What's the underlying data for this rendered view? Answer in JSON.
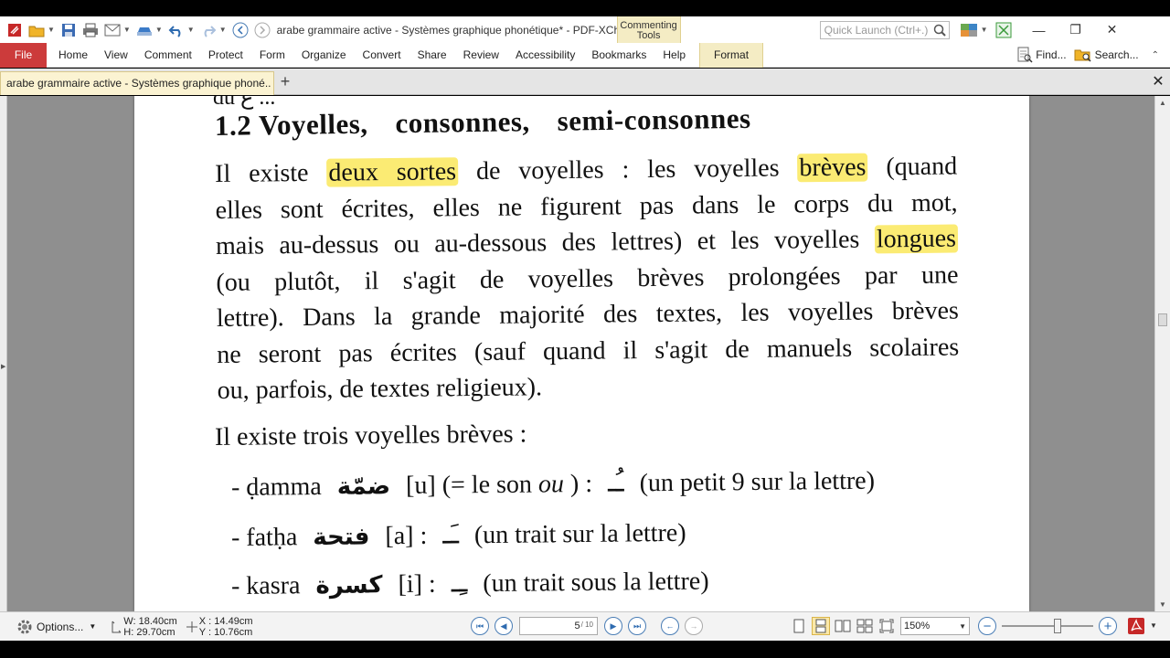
{
  "window": {
    "title": "arabe grammaire active - Systèmes graphique phonétique* - PDF-XChang...",
    "context_tab": "Commenting Tools",
    "quick_launch_placeholder": "Quick Launch (Ctrl+.)"
  },
  "menu": {
    "file": "File",
    "items": [
      "Home",
      "View",
      "Comment",
      "Protect",
      "Form",
      "Organize",
      "Convert",
      "Share",
      "Review",
      "Accessibility",
      "Bookmarks",
      "Help"
    ],
    "format": "Format",
    "find": "Find...",
    "search": "Search..."
  },
  "doc_tab": {
    "label": "arabe grammaire active - Systèmes graphique phoné.. *",
    "new_tab": "+",
    "close": "✕"
  },
  "document": {
    "cut_text": "du ع ...",
    "heading": [
      "1.2 Voyelles,",
      "consonnes,",
      "semi-consonnes"
    ],
    "para": {
      "l1_a": "Il existe",
      "l1_hl1": "deux sortes",
      "l1_b": "de voyelles : les voyelles",
      "l1_hl2": "brèves",
      "l1_c": "(quand",
      "l2": "elles sont écrites, elles ne figurent pas dans le corps du mot,",
      "l3_a": "mais au-dessus ou au-dessous des lettres) et les voyelles",
      "l3_hl": "longues",
      "l4": "(ou plutôt, il s'agit de voyelles brèves prolongées par une",
      "l5": "lettre). Dans la grande majorité des textes, les voyelles brèves",
      "l6": "ne seront pas écrites (sauf quand il s'agit de manuels scolaires",
      "l7": "ou, parfois, de textes religieux)."
    },
    "subheading": "Il existe trois voyelles brèves :",
    "vowels": [
      {
        "name": "- ḍamma",
        "arabic": "ضمّة",
        "sound": "[u] (= le son",
        "sound_it": "ou",
        "sound_end": ") :",
        "mark": "ـُـ",
        "desc": "(un petit 9 sur la lettre)"
      },
      {
        "name": "- fatḥa",
        "arabic": "فتحة",
        "sound": "[a] :",
        "mark": "ـَـ",
        "desc": "(un trait sur la lettre)"
      },
      {
        "name": "- kasra",
        "arabic": "كسرة",
        "sound": "[i] :",
        "mark": "ـِـ",
        "desc": "(un trait sous la lettre)"
      }
    ]
  },
  "status": {
    "options": "Options...",
    "width": "W: 18.40cm",
    "height": "H: 29.70cm",
    "x": "X : 14.49cm",
    "y": "Y : 10.76cm",
    "page_current": "5",
    "page_total": "/ 10",
    "zoom": "150%"
  },
  "colors": {
    "file_red": "#cc3b3b",
    "highlight": "#fbeb73",
    "context_tab": "#f4ecc4",
    "nav_blue": "#2e6bb0"
  }
}
